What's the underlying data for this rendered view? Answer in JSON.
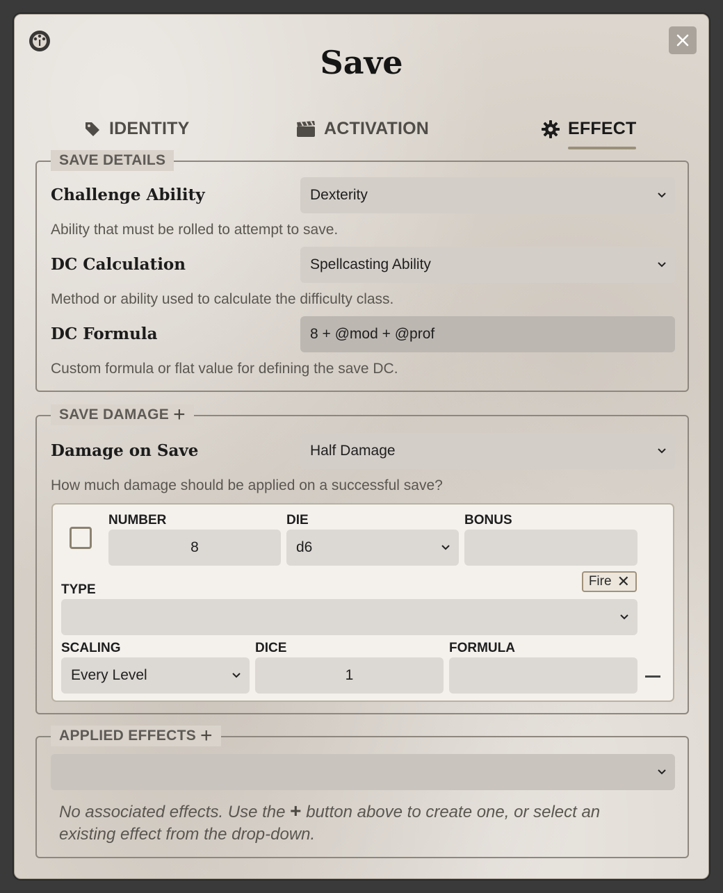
{
  "window": {
    "title": "Save",
    "app_icon": "d20-dial-icon",
    "close_icon": "close-icon"
  },
  "tabs": [
    {
      "label": "IDENTITY",
      "icon": "tag-icon",
      "active": false
    },
    {
      "label": "ACTIVATION",
      "icon": "clapperboard-icon",
      "active": false
    },
    {
      "label": "EFFECT",
      "icon": "gear-icon",
      "active": true
    }
  ],
  "save_details": {
    "legend": "SAVE DETAILS",
    "challenge_ability": {
      "label": "Challenge Ability",
      "value": "Dexterity",
      "hint": "Ability that must be rolled to attempt to save."
    },
    "dc_calculation": {
      "label": "DC Calculation",
      "value": "Spellcasting Ability",
      "hint": "Method or ability used to calculate the difficulty class."
    },
    "dc_formula": {
      "label": "DC Formula",
      "value": "8 + @mod + @prof",
      "hint": "Custom formula or flat value for defining the save DC."
    }
  },
  "save_damage": {
    "legend": "SAVE DAMAGE",
    "damage_on_save": {
      "label": "Damage on Save",
      "value": "Half Damage",
      "hint": "How much damage should be applied on a successful save?"
    },
    "part": {
      "number_label": "NUMBER",
      "number_value": "8",
      "die_label": "DIE",
      "die_value": "d6",
      "bonus_label": "BONUS",
      "bonus_value": "",
      "type_label": "TYPE",
      "type_tag": "Fire",
      "type_tag_remove": "✕",
      "type_value": "",
      "scaling_label": "SCALING",
      "scaling_value": "Every Level",
      "dice_label": "DICE",
      "dice_value": "1",
      "formula_label": "FORMULA",
      "formula_value": ""
    }
  },
  "applied_effects": {
    "legend": "APPLIED EFFECTS",
    "select_value": "",
    "notice_before": "No associated effects. Use the",
    "notice_plus": "+",
    "notice_after": "button above to create one, or select an existing effect from the drop-down."
  }
}
